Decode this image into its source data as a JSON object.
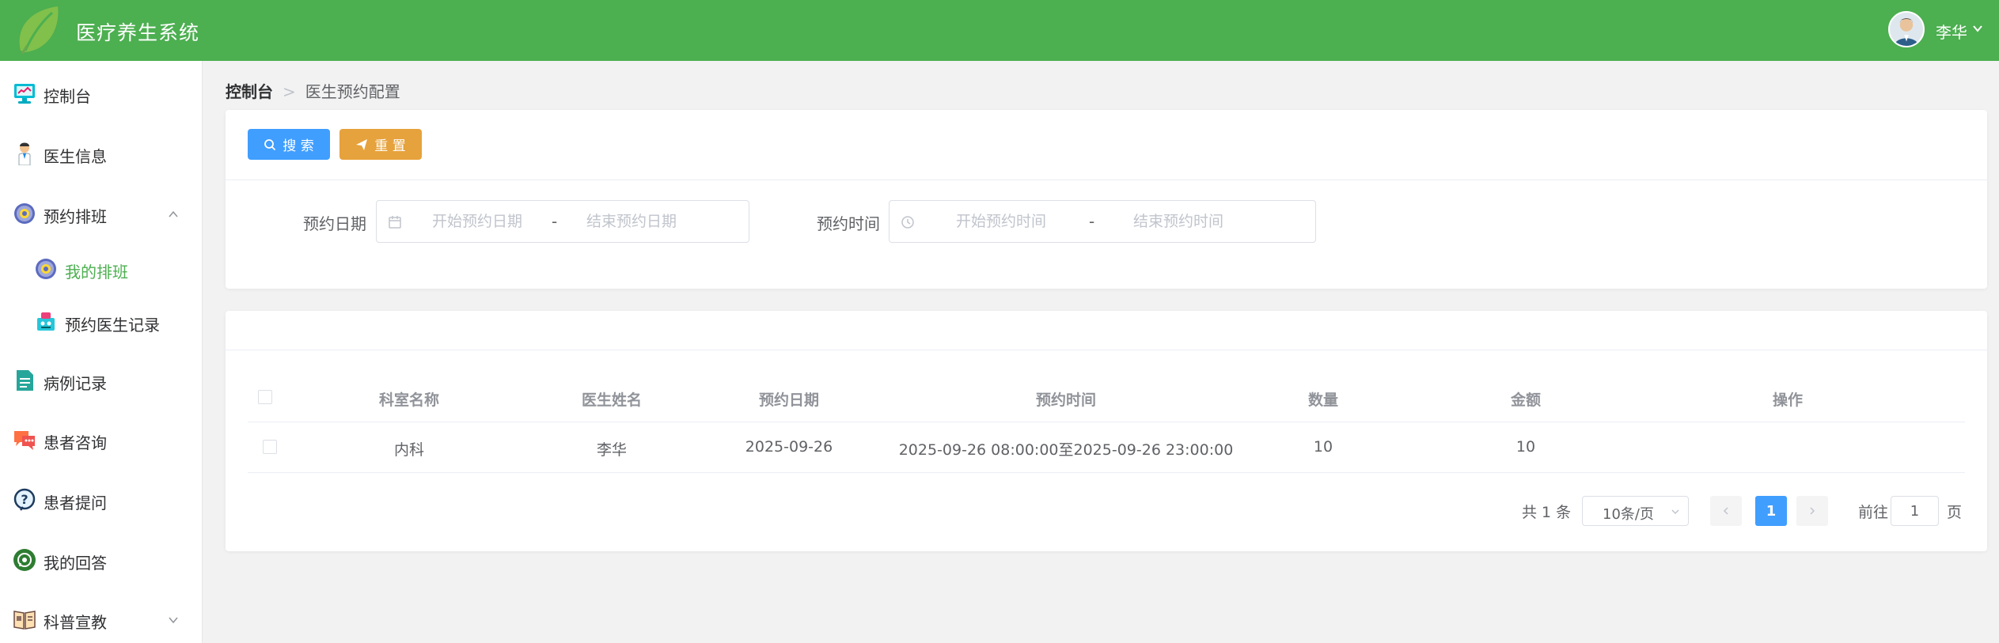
{
  "header": {
    "app_title": "医疗养生系统",
    "user_name": "李华",
    "bg_color": "#4caf50"
  },
  "sidebar": {
    "items": [
      {
        "label": "控制台",
        "icon": "monitor-icon"
      },
      {
        "label": "医生信息",
        "icon": "doctor-icon"
      },
      {
        "label": "预约排班",
        "icon": "gear-flower-icon",
        "expanded": true
      },
      {
        "label": "我的排班",
        "icon": "gear-flower-icon",
        "active": true
      },
      {
        "label": "预约医生记录",
        "icon": "robot-icon"
      },
      {
        "label": "病例记录",
        "icon": "document-icon"
      },
      {
        "label": "患者咨询",
        "icon": "chat-icon"
      },
      {
        "label": "患者提问",
        "icon": "question-icon"
      },
      {
        "label": "我的回答",
        "icon": "whatsapp-icon"
      },
      {
        "label": "科普宣教",
        "icon": "book-icon",
        "expanded": false
      }
    ]
  },
  "breadcrumb": {
    "home": "控制台",
    "separator": ">",
    "current": "医生预约配置"
  },
  "toolbar": {
    "search_label": "搜 索",
    "reset_label": "重 置"
  },
  "filters": {
    "date_label": "预约日期",
    "date_start_placeholder": "开始预约日期",
    "date_end_placeholder": "结束预约日期",
    "time_label": "预约时间",
    "time_start_placeholder": "开始预约时间",
    "time_end_placeholder": "结束预约时间",
    "dash": "-"
  },
  "table": {
    "columns": [
      "科室名称",
      "医生姓名",
      "预约日期",
      "预约时间",
      "数量",
      "金额",
      "操作"
    ],
    "rows": [
      [
        "内科",
        "李华",
        "2025-09-26",
        "2025-09-26 08:00:00至2025-09-26 23:00:00",
        "10",
        "10",
        ""
      ]
    ]
  },
  "pagination": {
    "total": "共 1 条",
    "page_size": "10条/页",
    "current_page": "1",
    "goto_label": "前往",
    "goto_value": "1",
    "page_suffix": "页"
  }
}
